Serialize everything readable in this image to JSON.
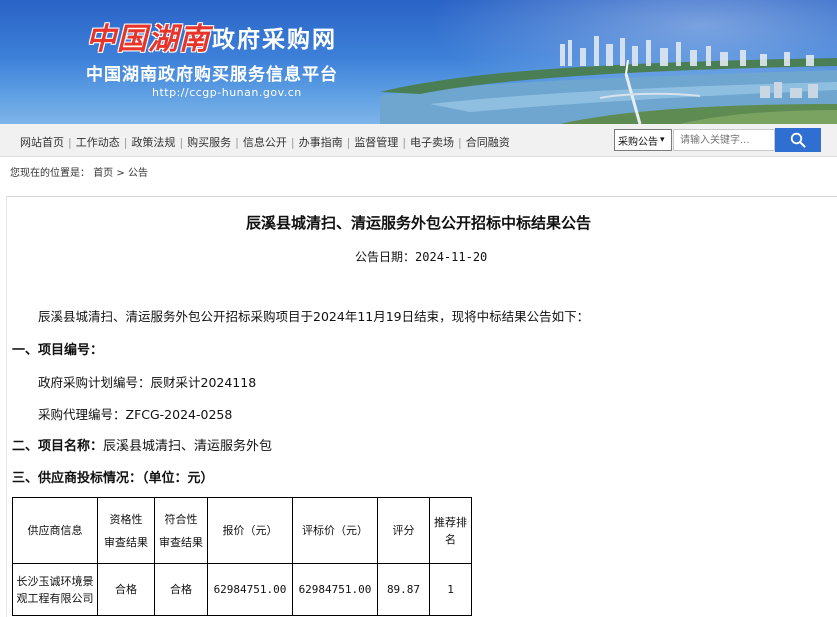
{
  "header": {
    "logo_script": "中国湖南",
    "logo_title": "政府采购网",
    "subtitle": "中国湖南政府购买服务信息平台",
    "url": "http://ccgp-hunan.gov.cn"
  },
  "nav": {
    "items": [
      "网站首页",
      "工作动态",
      "政策法规",
      "购买服务",
      "信息公开",
      "办事指南",
      "监督管理",
      "电子卖场",
      "合同融资"
    ]
  },
  "search": {
    "select_value": "采购公告",
    "placeholder": "请输入关键字..."
  },
  "breadcrumb": {
    "prefix": "您现在的位置是：",
    "home": "首页",
    "sep": ">",
    "current": "公告"
  },
  "article": {
    "title": "辰溪县城清扫、清运服务外包公开招标中标结果公告",
    "date_label": "公告日期：",
    "date_value": "2024-11-20",
    "intro": "辰溪县城清扫、清运服务外包公开招标采购项目于2024年11月19日结束，现将中标结果公告如下：",
    "s1_heading": "一、项目编号：",
    "plan_no": "政府采购计划编号：辰财采计2024118",
    "agency_no": "采购代理编号：ZFCG-2024-0258",
    "s2_heading": "二、项目名称：",
    "s2_value": "辰溪县城清扫、清运服务外包",
    "s3_heading": "三、供应商投标情况：（单位：元）"
  },
  "table": {
    "headers": {
      "supplier": "供应商信息",
      "qual_top": "资格性",
      "qual_bottom": "审查结果",
      "comp_top": "符合性",
      "comp_bottom": "审查结果",
      "price": "报价（元）",
      "eval_price": "评标价（元）",
      "score": "评分",
      "rank": "推荐排名"
    },
    "rows": [
      {
        "supplier": "长沙玉诚环境景观工程有限公司",
        "qual": "合格",
        "comp": "合格",
        "price": "62984751.00",
        "eval_price": "62984751.00",
        "score": "89.87",
        "rank": "1"
      }
    ]
  }
}
